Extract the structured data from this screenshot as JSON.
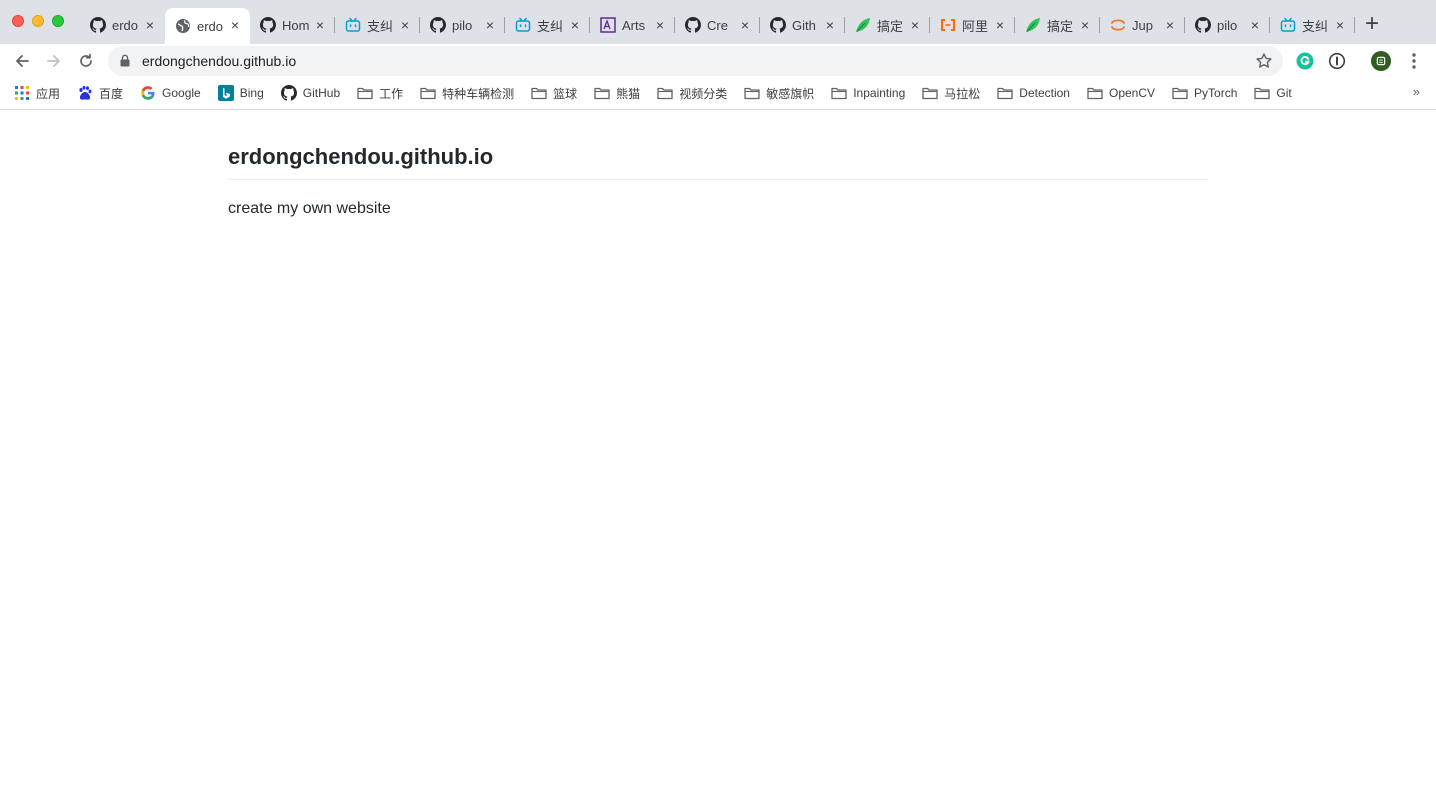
{
  "browser": {
    "tabs": [
      {
        "title": "erdo",
        "icon": "github-icon",
        "active": false
      },
      {
        "title": "erdo",
        "icon": "globe-icon",
        "active": true
      },
      {
        "title": "Hom",
        "icon": "github-icon",
        "active": false
      },
      {
        "title": "支纠",
        "icon": "bilibili-icon",
        "active": false
      },
      {
        "title": "pilo",
        "icon": "github-icon",
        "active": false
      },
      {
        "title": "支纠",
        "icon": "bilibili-icon",
        "active": false
      },
      {
        "title": "Arts",
        "icon": "arts-icon",
        "active": false
      },
      {
        "title": "Cre",
        "icon": "github-icon",
        "active": false
      },
      {
        "title": "Gith",
        "icon": "github-icon",
        "active": false
      },
      {
        "title": "搞定",
        "icon": "leaf-icon",
        "active": false
      },
      {
        "title": "阿里",
        "icon": "aliyun-icon",
        "active": false
      },
      {
        "title": "搞定",
        "icon": "leaf-icon",
        "active": false
      },
      {
        "title": "Jup",
        "icon": "jupyter-icon",
        "active": false
      },
      {
        "title": "pilo",
        "icon": "github-icon",
        "active": false
      },
      {
        "title": "支纠",
        "icon": "bilibili-icon",
        "active": false
      }
    ],
    "new_tab_label": "+",
    "close_label": "×",
    "address": "erdongchendou.github.io",
    "bookmarks": [
      {
        "label": "应用",
        "icon": "apps-grid-icon"
      },
      {
        "label": "百度",
        "icon": "baidu-icon"
      },
      {
        "label": "Google",
        "icon": "google-icon"
      },
      {
        "label": "Bing",
        "icon": "bing-icon"
      },
      {
        "label": "GitHub",
        "icon": "github-icon"
      },
      {
        "label": "工作",
        "icon": "folder-icon"
      },
      {
        "label": "特种车辆检测",
        "icon": "folder-icon"
      },
      {
        "label": "篮球",
        "icon": "folder-icon"
      },
      {
        "label": "熊猫",
        "icon": "folder-icon"
      },
      {
        "label": "视频分类",
        "icon": "folder-icon"
      },
      {
        "label": "敏感旗帜",
        "icon": "folder-icon"
      },
      {
        "label": "Inpainting",
        "icon": "folder-icon"
      },
      {
        "label": "马拉松",
        "icon": "folder-icon"
      },
      {
        "label": "Detection",
        "icon": "folder-icon"
      },
      {
        "label": "OpenCV",
        "icon": "folder-icon"
      },
      {
        "label": "PyTorch",
        "icon": "folder-icon"
      },
      {
        "label": "Git",
        "icon": "folder-icon"
      }
    ],
    "bookmarks_more": "»",
    "colors": {
      "tabstrip": "#dee1e6",
      "omnibox": "#f1f3f4",
      "grammarly": "#15c39a",
      "profile": "#2e5e1e"
    }
  },
  "page": {
    "title": "erdongchendou.github.io",
    "description": "create my own website"
  }
}
